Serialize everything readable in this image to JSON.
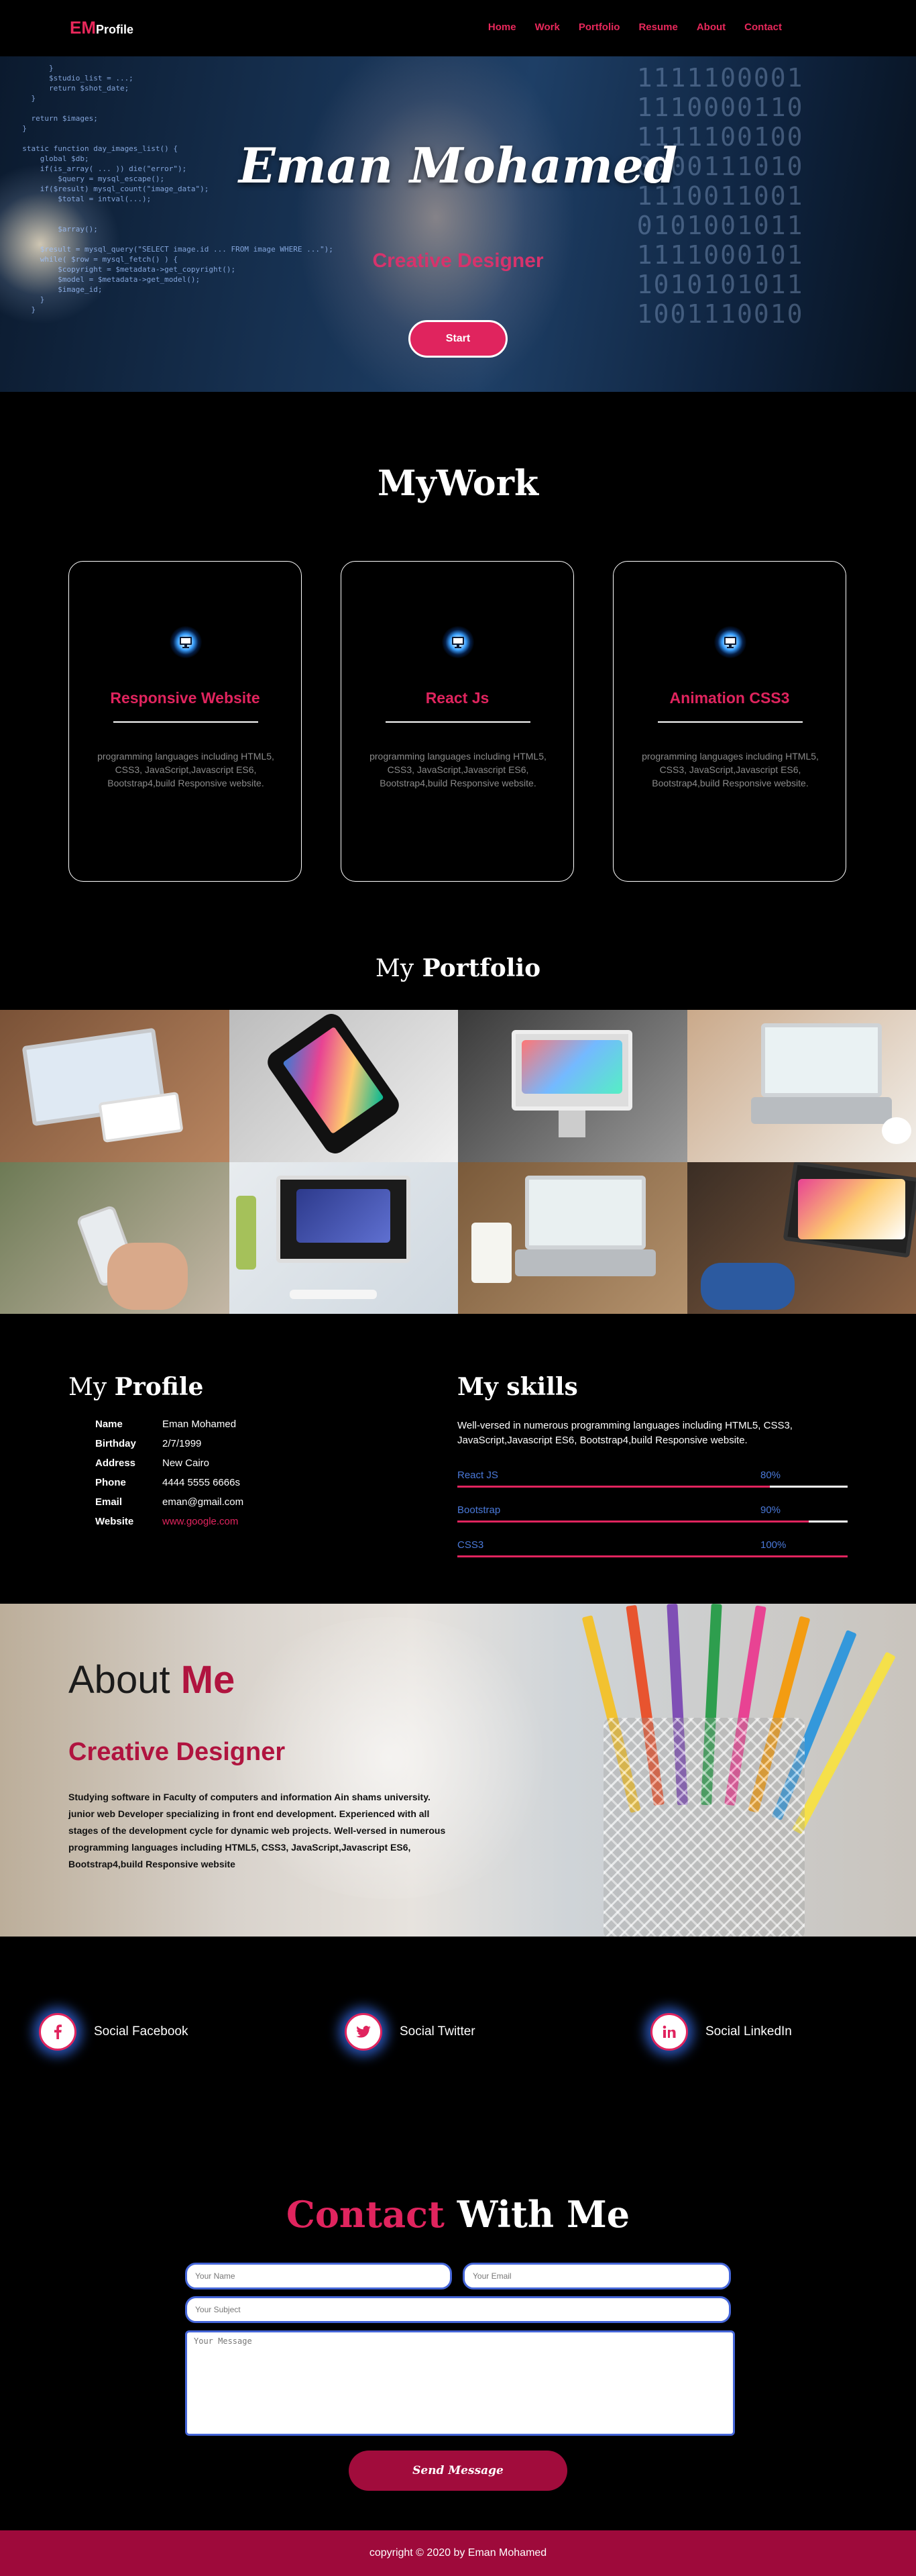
{
  "nav": {
    "logo_em": "EM",
    "logo_profile": "Profile",
    "items": [
      "Home",
      "Work",
      "Portfolio",
      "Resume",
      "About",
      "Contact"
    ]
  },
  "hero": {
    "title": "Eman Mohamed",
    "subtitle": "Creative Designer",
    "start_label": "Start"
  },
  "work": {
    "title": "MyWork",
    "cards": [
      {
        "title": "Responsive Website",
        "icon": "monitor-icon",
        "desc": "programming languages including HTML5, CSS3, JavaScript,Javascript ES6, Bootstrap4,build Responsive website."
      },
      {
        "title": "React Js",
        "icon": "monitor-icon",
        "desc": "programming languages including HTML5, CSS3, JavaScript,Javascript ES6, Bootstrap4,build Responsive website."
      },
      {
        "title": "Animation CSS3",
        "icon": "monitor-icon",
        "desc": "programming languages including HTML5, CSS3, JavaScript,Javascript ES6, Bootstrap4,build Responsive website."
      }
    ]
  },
  "portfolio": {
    "title_light": "My",
    "title_bold": "Portfolio"
  },
  "profile": {
    "title_light": "My",
    "title_bold": "Profile",
    "rows": [
      {
        "k": "Name",
        "v": "Eman Mohamed"
      },
      {
        "k": "Birthday",
        "v": "2/7/1999"
      },
      {
        "k": "Address",
        "v": "New Cairo"
      },
      {
        "k": "Phone",
        "v": "4444 5555 6666s"
      },
      {
        "k": "Email",
        "v": "eman@gmail.com"
      },
      {
        "k": "Website",
        "v": "www.google.com"
      }
    ]
  },
  "skills": {
    "title": "My skills",
    "desc": "Well-versed in numerous programming languages including HTML5, CSS3, JavaScript,Javascript ES6, Bootstrap4,build Responsive website.",
    "items": [
      {
        "name": "React JS",
        "percent_label": "80%",
        "level": 0.8
      },
      {
        "name": "Bootstrap",
        "percent_label": "90%",
        "level": 0.9
      },
      {
        "name": "CSS3",
        "percent_label": "100%",
        "level": 1.0
      }
    ]
  },
  "about": {
    "title_light": "About",
    "title_bold": "Me",
    "subtitle": "Creative Designer",
    "text": "Studying software in Faculty of computers and information Ain shams university. junior web Developer specializing in front end development. Experienced with all stages of the development cycle for dynamic web projects. Well-versed in numerous programming languages including HTML5, CSS3, JavaScript,Javascript ES6, Bootstrap4,build Responsive website"
  },
  "social": [
    {
      "label": "Social Facebook",
      "icon": "facebook-icon"
    },
    {
      "label": "Social Twitter",
      "icon": "twitter-icon"
    },
    {
      "label": "Social LinkedIn",
      "icon": "linkedin-icon"
    }
  ],
  "contact": {
    "title_color": "Contact",
    "title_rest": "With Me",
    "name_placeholder": "Your Name",
    "email_placeholder": "Your Email",
    "subject_placeholder": "Your Subject",
    "message_placeholder": "Your Message",
    "send_label": "Send Message"
  },
  "footer": {
    "text": "copyright © 2020 by Eman Mohamed"
  },
  "colors": {
    "accent": "#e0245e",
    "dark_accent": "#9e0a3b",
    "link_blue": "#4a79d9"
  }
}
